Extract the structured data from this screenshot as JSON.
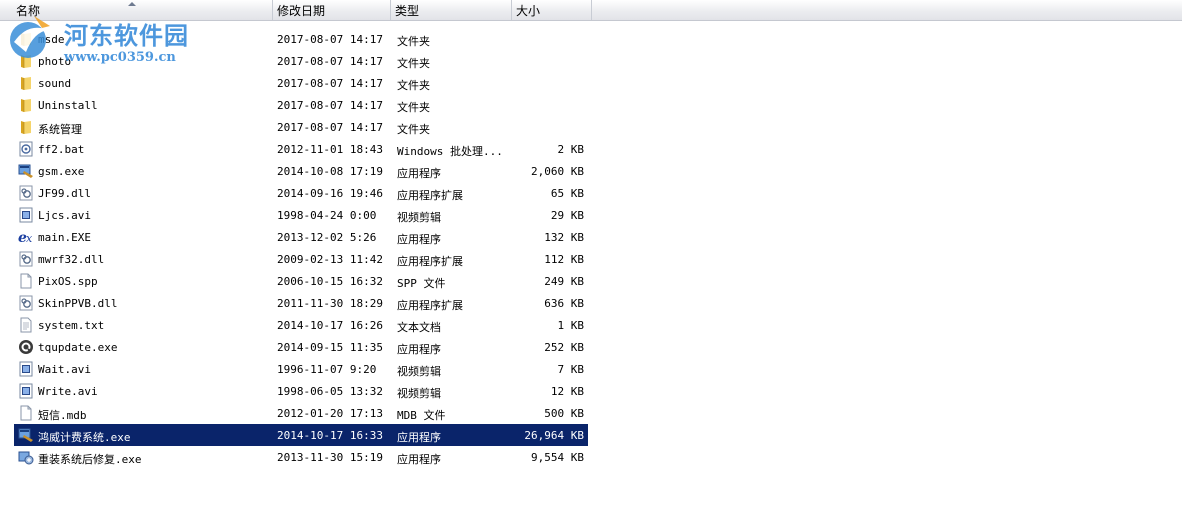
{
  "columns": {
    "name": "名称",
    "date": "修改日期",
    "type": "类型",
    "size": "大小"
  },
  "watermark": {
    "title": "河东软件园",
    "url": "www.pc0359.cn"
  },
  "files": [
    {
      "name": "msde",
      "date": "2017-08-07 14:17",
      "type": "文件夹",
      "size": "",
      "icon": "folder-icon"
    },
    {
      "name": "photo",
      "date": "2017-08-07 14:17",
      "type": "文件夹",
      "size": "",
      "icon": "folder-icon"
    },
    {
      "name": "sound",
      "date": "2017-08-07 14:17",
      "type": "文件夹",
      "size": "",
      "icon": "folder-icon"
    },
    {
      "name": "Uninstall",
      "date": "2017-08-07 14:17",
      "type": "文件夹",
      "size": "",
      "icon": "folder-icon"
    },
    {
      "name": "系统管理",
      "date": "2017-08-07 14:17",
      "type": "文件夹",
      "size": "",
      "icon": "folder-icon"
    },
    {
      "name": "ff2.bat",
      "date": "2012-11-01 18:43",
      "type": "Windows 批处理...",
      "size": "2 KB",
      "icon": "batch-file-icon"
    },
    {
      "name": "gsm.exe",
      "date": "2014-10-08 17:19",
      "type": "应用程序",
      "size": "2,060 KB",
      "icon": "app-icon"
    },
    {
      "name": "JF99.dll",
      "date": "2014-09-16 19:46",
      "type": "应用程序扩展",
      "size": "65 KB",
      "icon": "dll-icon"
    },
    {
      "name": "Ljcs.avi",
      "date": "1998-04-24 0:00",
      "type": "视频剪辑",
      "size": "29 KB",
      "icon": "video-icon"
    },
    {
      "name": "main.EXE",
      "date": "2013-12-02 5:26",
      "type": "应用程序",
      "size": "132 KB",
      "icon": "app-logo-icon"
    },
    {
      "name": "mwrf32.dll",
      "date": "2009-02-13 11:42",
      "type": "应用程序扩展",
      "size": "112 KB",
      "icon": "dll-icon"
    },
    {
      "name": "PixOS.spp",
      "date": "2006-10-15 16:32",
      "type": "SPP 文件",
      "size": "249 KB",
      "icon": "file-icon"
    },
    {
      "name": "SkinPPVB.dll",
      "date": "2011-11-30 18:29",
      "type": "应用程序扩展",
      "size": "636 KB",
      "icon": "dll-icon"
    },
    {
      "name": "system.txt",
      "date": "2014-10-17 16:26",
      "type": "文本文档",
      "size": "1 KB",
      "icon": "text-file-icon"
    },
    {
      "name": "tqupdate.exe",
      "date": "2014-09-15 11:35",
      "type": "应用程序",
      "size": "252 KB",
      "icon": "update-icon"
    },
    {
      "name": "Wait.avi",
      "date": "1996-11-07 9:20",
      "type": "视频剪辑",
      "size": "7 KB",
      "icon": "video-icon"
    },
    {
      "name": "Write.avi",
      "date": "1998-06-05 13:32",
      "type": "视频剪辑",
      "size": "12 KB",
      "icon": "video-icon"
    },
    {
      "name": "短信.mdb",
      "date": "2012-01-20 17:13",
      "type": "MDB 文件",
      "size": "500 KB",
      "icon": "file-icon"
    },
    {
      "name": "鸿威计费系统.exe",
      "date": "2014-10-17 16:33",
      "type": "应用程序",
      "size": "26,964 KB",
      "icon": "app-icon",
      "selected": true
    },
    {
      "name": "重装系统后修复.exe",
      "date": "2013-11-30 15:19",
      "type": "应用程序",
      "size": "9,554 KB",
      "icon": "setup-icon"
    }
  ]
}
